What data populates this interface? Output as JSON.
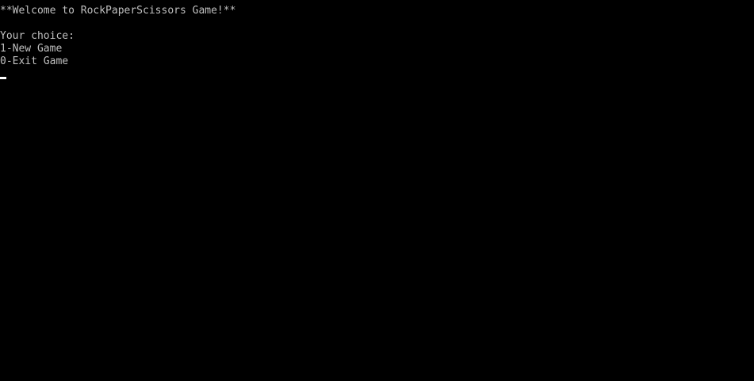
{
  "console": {
    "welcome": "**Welcome to RockPaperScissors Game!**",
    "prompt": "Your choice:",
    "options": [
      "1-New Game",
      "0-Exit Game"
    ],
    "background_color": "#000000",
    "text_color": "#c0c0c0",
    "cursor_color": "#ffffff"
  }
}
